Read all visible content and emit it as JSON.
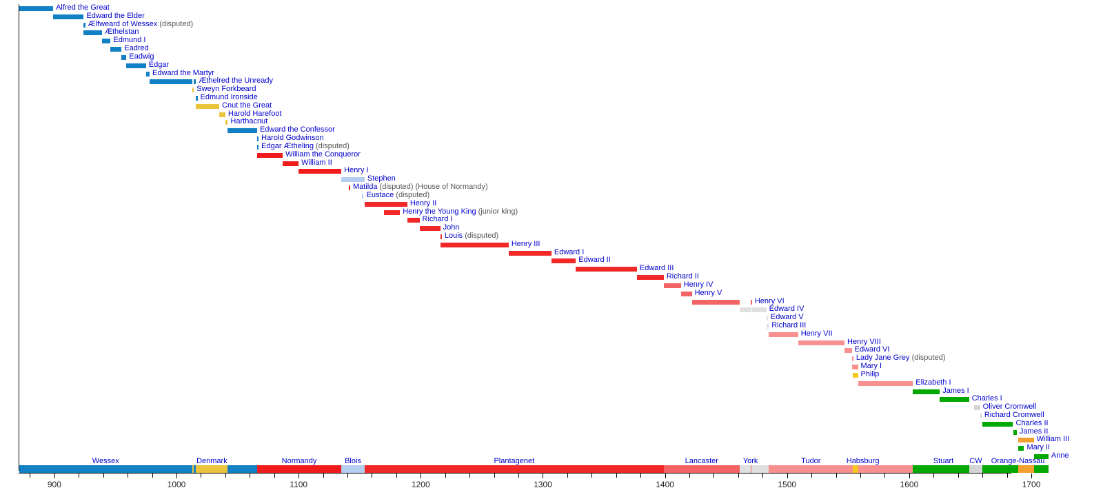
{
  "chart_data": {
    "type": "bar",
    "title": "",
    "subtitle": "",
    "xlabel": "",
    "ylabel": "",
    "orientation": "horizontal-timeline",
    "grid": false,
    "legend": "none",
    "xlim": [
      871,
      1714
    ],
    "axis": {
      "tick_step": 20,
      "label_step": 100,
      "labels": [
        "900",
        "1000",
        "1100",
        "1200",
        "1300",
        "1400",
        "1500",
        "1600",
        "1700"
      ],
      "label_values": [
        900,
        1000,
        1100,
        1200,
        1300,
        1400,
        1500,
        1600,
        1700
      ]
    },
    "colors": {
      "wessex": "#1280c4",
      "denmark": "#ebc43c",
      "normandy": "#f01c1c",
      "blois": "#b4cef0",
      "plantagenet": "#f02828",
      "lancaster": "#f46464",
      "york": "#e0e0e0",
      "tudor": "#f89090",
      "habsburg": "#f5c820",
      "stuart": "#00a800",
      "commonwealth": "#d4d4d4",
      "orange_nassau": "#f4a030",
      "label_text": "#0000cc",
      "note_text": "#555555",
      "axis": "#000000"
    },
    "rows": [
      {
        "name": "Alfred the Great",
        "note": "",
        "segments": [
          {
            "start": 871,
            "end": 899,
            "house": "wessex"
          }
        ]
      },
      {
        "name": "Edward the Elder",
        "note": "",
        "segments": [
          {
            "start": 899,
            "end": 924,
            "house": "wessex"
          }
        ]
      },
      {
        "name": "Ælfweard of Wessex",
        "note": "(disputed)",
        "segments": [
          {
            "start": 924,
            "end": 924.1,
            "house": "wessex"
          }
        ]
      },
      {
        "name": "Æthelstan",
        "note": "",
        "segments": [
          {
            "start": 924,
            "end": 939,
            "house": "wessex"
          }
        ]
      },
      {
        "name": "Edmund I",
        "note": "",
        "segments": [
          {
            "start": 939,
            "end": 946,
            "house": "wessex"
          }
        ]
      },
      {
        "name": "Eadred",
        "note": "",
        "segments": [
          {
            "start": 946,
            "end": 955,
            "house": "wessex"
          }
        ]
      },
      {
        "name": "Eadwig",
        "note": "",
        "segments": [
          {
            "start": 955,
            "end": 959,
            "house": "wessex"
          }
        ]
      },
      {
        "name": "Edgar",
        "note": "",
        "segments": [
          {
            "start": 959,
            "end": 975,
            "house": "wessex"
          }
        ]
      },
      {
        "name": "Edward the Martyr",
        "note": "",
        "segments": [
          {
            "start": 975,
            "end": 978,
            "house": "wessex"
          }
        ]
      },
      {
        "name": "Æthelred the Unready",
        "note": "",
        "segments": [
          {
            "start": 978,
            "end": 1013,
            "house": "wessex"
          },
          {
            "start": 1014,
            "end": 1016,
            "house": "wessex"
          }
        ]
      },
      {
        "name": "Sweyn Forkbeard",
        "note": "",
        "segments": [
          {
            "start": 1013,
            "end": 1014,
            "house": "denmark"
          }
        ]
      },
      {
        "name": "Edmund Ironside",
        "note": "",
        "segments": [
          {
            "start": 1016,
            "end": 1016.6,
            "house": "wessex"
          }
        ]
      },
      {
        "name": "Cnut the Great",
        "note": "",
        "segments": [
          {
            "start": 1016,
            "end": 1035,
            "house": "denmark"
          }
        ]
      },
      {
        "name": "Harold Harefoot",
        "note": "",
        "segments": [
          {
            "start": 1035,
            "end": 1040,
            "house": "denmark"
          }
        ]
      },
      {
        "name": "Harthacnut",
        "note": "",
        "segments": [
          {
            "start": 1040,
            "end": 1042,
            "house": "denmark"
          }
        ]
      },
      {
        "name": "Edward the Confessor",
        "note": "",
        "segments": [
          {
            "start": 1042,
            "end": 1066,
            "house": "wessex"
          }
        ]
      },
      {
        "name": "Harold Godwinson",
        "note": "",
        "segments": [
          {
            "start": 1066,
            "end": 1066.8,
            "house": "wessex"
          }
        ]
      },
      {
        "name": "Edgar Ætheling",
        "note": "(disputed)",
        "segments": [
          {
            "start": 1066,
            "end": 1066.9,
            "house": "wessex"
          }
        ]
      },
      {
        "name": "William the Conqueror",
        "note": "",
        "segments": [
          {
            "start": 1066,
            "end": 1087,
            "house": "normandy"
          }
        ]
      },
      {
        "name": "William II",
        "note": "",
        "segments": [
          {
            "start": 1087,
            "end": 1100,
            "house": "normandy"
          }
        ]
      },
      {
        "name": "Henry I",
        "note": "",
        "segments": [
          {
            "start": 1100,
            "end": 1135,
            "house": "normandy"
          }
        ]
      },
      {
        "name": "Stephen",
        "note": "",
        "segments": [
          {
            "start": 1135,
            "end": 1154,
            "house": "blois"
          }
        ]
      },
      {
        "name": "Matilda",
        "note": "(disputed) (House of Normandy)",
        "segments": [
          {
            "start": 1141,
            "end": 1141.8,
            "house": "normandy"
          }
        ]
      },
      {
        "name": "Eustace",
        "note": "(disputed)",
        "segments": [
          {
            "start": 1152,
            "end": 1153,
            "house": "blois"
          }
        ]
      },
      {
        "name": "Henry II",
        "note": "",
        "segments": [
          {
            "start": 1154,
            "end": 1189,
            "house": "plantagenet"
          }
        ]
      },
      {
        "name": "Henry the Young King",
        "note": "(junior king)",
        "segments": [
          {
            "start": 1170,
            "end": 1183,
            "house": "plantagenet"
          }
        ]
      },
      {
        "name": "Richard I",
        "note": "",
        "segments": [
          {
            "start": 1189,
            "end": 1199,
            "house": "plantagenet"
          }
        ]
      },
      {
        "name": "John",
        "note": "",
        "segments": [
          {
            "start": 1199,
            "end": 1216,
            "house": "plantagenet"
          }
        ]
      },
      {
        "name": "Louis",
        "note": "(disputed)",
        "segments": [
          {
            "start": 1216,
            "end": 1217,
            "house": "plantagenet"
          }
        ]
      },
      {
        "name": "Henry III",
        "note": "",
        "segments": [
          {
            "start": 1216,
            "end": 1272,
            "house": "plantagenet"
          }
        ]
      },
      {
        "name": "Edward I",
        "note": "",
        "segments": [
          {
            "start": 1272,
            "end": 1307,
            "house": "plantagenet"
          }
        ]
      },
      {
        "name": "Edward II",
        "note": "",
        "segments": [
          {
            "start": 1307,
            "end": 1327,
            "house": "plantagenet"
          }
        ]
      },
      {
        "name": "Edward III",
        "note": "",
        "segments": [
          {
            "start": 1327,
            "end": 1377,
            "house": "plantagenet"
          }
        ]
      },
      {
        "name": "Richard II",
        "note": "",
        "segments": [
          {
            "start": 1377,
            "end": 1399,
            "house": "plantagenet"
          }
        ]
      },
      {
        "name": "Henry IV",
        "note": "",
        "segments": [
          {
            "start": 1399,
            "end": 1413,
            "house": "lancaster"
          }
        ]
      },
      {
        "name": "Henry V",
        "note": "",
        "segments": [
          {
            "start": 1413,
            "end": 1422,
            "house": "lancaster"
          }
        ]
      },
      {
        "name": "Henry VI",
        "note": "",
        "segments": [
          {
            "start": 1422,
            "end": 1461,
            "house": "lancaster"
          },
          {
            "start": 1470,
            "end": 1471,
            "house": "lancaster"
          }
        ]
      },
      {
        "name": "Edward IV",
        "note": "",
        "segments": [
          {
            "start": 1461,
            "end": 1470,
            "house": "york"
          },
          {
            "start": 1471,
            "end": 1483,
            "house": "york"
          }
        ]
      },
      {
        "name": "Edward V",
        "note": "",
        "segments": [
          {
            "start": 1483,
            "end": 1483.4,
            "house": "york"
          }
        ]
      },
      {
        "name": "Richard III",
        "note": "",
        "segments": [
          {
            "start": 1483,
            "end": 1485,
            "house": "york"
          }
        ]
      },
      {
        "name": "Henry VII",
        "note": "",
        "segments": [
          {
            "start": 1485,
            "end": 1509,
            "house": "tudor"
          }
        ]
      },
      {
        "name": "Henry VIII",
        "note": "",
        "segments": [
          {
            "start": 1509,
            "end": 1547,
            "house": "tudor"
          }
        ]
      },
      {
        "name": "Edward VI",
        "note": "",
        "segments": [
          {
            "start": 1547,
            "end": 1553,
            "house": "tudor"
          }
        ]
      },
      {
        "name": "Lady Jane Grey",
        "note": "(disputed)",
        "segments": [
          {
            "start": 1553,
            "end": 1553.5,
            "house": "tudor"
          }
        ]
      },
      {
        "name": "Mary I",
        "note": "",
        "segments": [
          {
            "start": 1553,
            "end": 1558,
            "house": "tudor"
          }
        ]
      },
      {
        "name": "Philip",
        "note": "",
        "segments": [
          {
            "start": 1554,
            "end": 1558,
            "house": "habsburg"
          }
        ]
      },
      {
        "name": "Elizabeth I",
        "note": "",
        "segments": [
          {
            "start": 1558,
            "end": 1603,
            "house": "tudor"
          }
        ]
      },
      {
        "name": "James I",
        "note": "",
        "segments": [
          {
            "start": 1603,
            "end": 1625,
            "house": "stuart"
          }
        ]
      },
      {
        "name": "Charles I",
        "note": "",
        "segments": [
          {
            "start": 1625,
            "end": 1649,
            "house": "stuart"
          }
        ]
      },
      {
        "name": "Oliver Cromwell",
        "note": "",
        "segments": [
          {
            "start": 1653,
            "end": 1658,
            "house": "commonwealth"
          }
        ]
      },
      {
        "name": "Richard Cromwell",
        "note": "",
        "segments": [
          {
            "start": 1658,
            "end": 1659,
            "house": "commonwealth"
          }
        ]
      },
      {
        "name": "Charles II",
        "note": "",
        "segments": [
          {
            "start": 1660,
            "end": 1685,
            "house": "stuart"
          }
        ]
      },
      {
        "name": "James II",
        "note": "",
        "segments": [
          {
            "start": 1685,
            "end": 1688,
            "house": "stuart"
          }
        ]
      },
      {
        "name": "William III",
        "note": "",
        "segments": [
          {
            "start": 1689,
            "end": 1702,
            "house": "orange_nassau"
          }
        ]
      },
      {
        "name": "Mary II",
        "note": "",
        "segments": [
          {
            "start": 1689,
            "end": 1694,
            "house": "stuart"
          }
        ]
      },
      {
        "name": "Anne",
        "note": "",
        "segments": [
          {
            "start": 1702,
            "end": 1714,
            "house": "stuart"
          }
        ]
      }
    ],
    "houses": [
      {
        "label": "Wessex",
        "start": 871,
        "end": 1013,
        "house": "wessex",
        "show_label": true
      },
      {
        "label": "Denmark-a",
        "start": 1013,
        "end": 1014,
        "house": "denmark",
        "show_label": false
      },
      {
        "label": "Wessex-b",
        "start": 1014,
        "end": 1016,
        "house": "wessex",
        "show_label": false
      },
      {
        "label": "Denmark",
        "start": 1016,
        "end": 1042,
        "house": "denmark",
        "show_label": true
      },
      {
        "label": "Wessex-c",
        "start": 1042,
        "end": 1066,
        "house": "wessex",
        "show_label": false
      },
      {
        "label": "Normandy",
        "start": 1066,
        "end": 1135,
        "house": "normandy",
        "show_label": true
      },
      {
        "label": "Blois",
        "start": 1135,
        "end": 1154,
        "house": "blois",
        "show_label": true
      },
      {
        "label": "Plantagenet",
        "start": 1154,
        "end": 1399,
        "house": "plantagenet",
        "show_label": true
      },
      {
        "label": "Lancaster",
        "start": 1399,
        "end": 1461,
        "house": "lancaster",
        "show_label": true
      },
      {
        "label": "York",
        "start": 1461,
        "end": 1470,
        "house": "york",
        "show_label": false
      },
      {
        "label": "Lancaster-b",
        "start": 1470,
        "end": 1471,
        "house": "lancaster",
        "show_label": false
      },
      {
        "label": "York",
        "start": 1471,
        "end": 1485,
        "house": "york",
        "show_label": true
      },
      {
        "label": "Tudor",
        "start": 1485,
        "end": 1554,
        "house": "tudor",
        "show_label": true
      },
      {
        "label": "Habsburg",
        "start": 1554,
        "end": 1558,
        "house": "habsburg",
        "show_label": true
      },
      {
        "label": "Tudor-b",
        "start": 1558,
        "end": 1603,
        "house": "tudor",
        "show_label": false
      },
      {
        "label": "Stuart",
        "start": 1603,
        "end": 1649,
        "house": "stuart",
        "show_label": true
      },
      {
        "label": "CW",
        "start": 1649,
        "end": 1660,
        "house": "commonwealth",
        "show_label": true
      },
      {
        "label": "Stuart-b",
        "start": 1660,
        "end": 1689,
        "house": "stuart",
        "show_label": false
      },
      {
        "label": "Orange-Nassau",
        "start": 1689,
        "end": 1702,
        "house": "orange_nassau",
        "show_label": true
      },
      {
        "label": "Stuart-c",
        "start": 1702,
        "end": 1714,
        "house": "stuart",
        "show_label": false
      }
    ],
    "house_label_overrides": [
      {
        "label": "York",
        "center": 1470
      },
      {
        "label": "Habsburg",
        "center": 1562
      },
      {
        "label": "Stuart",
        "center": 1628
      },
      {
        "label": "Orange-Nassau",
        "center": 1689
      }
    ]
  }
}
